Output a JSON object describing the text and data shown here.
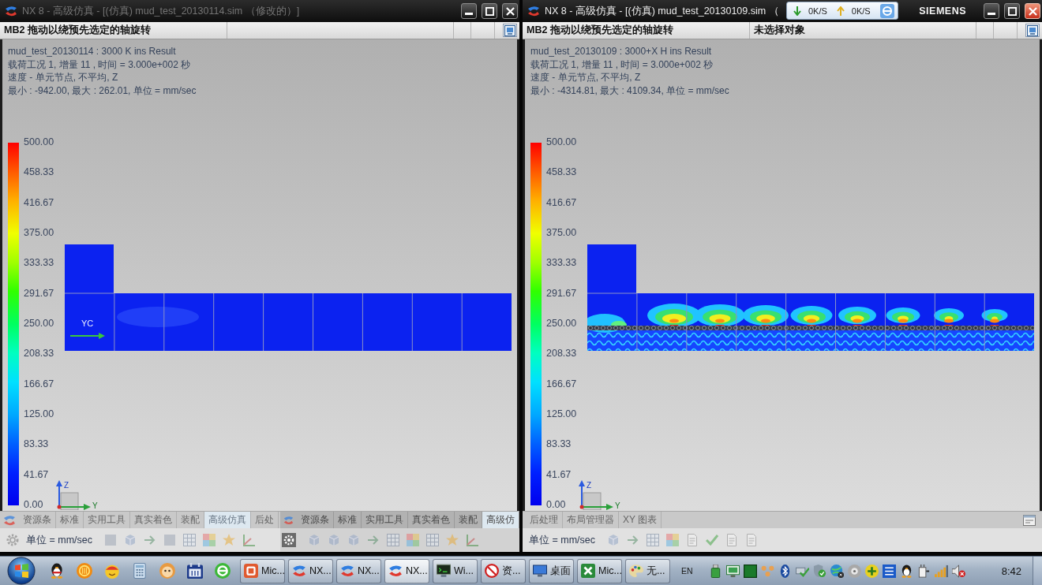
{
  "windows": [
    {
      "title": "NX 8 - 高级仿真 - [(仿真) mud_test_20130114.sim （修改的）]",
      "active": false,
      "cue": "MB2 拖动以绕预先选定的轴旋转",
      "info_lines": [
        "mud_test_20130114 : 3000 K ins Result",
        "载荷工况 1, 增量 11 , 时间 =  3.000e+002 秒",
        "速度 - 单元节点, 不平均, Z",
        "最小 : -942.00, 最大 : 262.01, 单位 = mm/sec"
      ],
      "legend_labels": [
        "500.00",
        "458.33",
        "416.67",
        "375.00",
        "333.33",
        "291.67",
        "250.00",
        "208.33",
        "166.67",
        "125.00",
        "83.33",
        "41.67",
        "0.00"
      ],
      "plot": {
        "kind": "uniform",
        "wcs_label": "YC"
      },
      "triad_labels": [
        "Z",
        "Y"
      ],
      "ribbon_tabs": [
        {
          "label": "资源条",
          "selected": false
        },
        {
          "label": "标准",
          "selected": false
        },
        {
          "label": "实用工具",
          "selected": false
        },
        {
          "label": "真实着色",
          "selected": false
        },
        {
          "label": "装配",
          "selected": false
        },
        {
          "label": "高级仿真",
          "selected": true
        },
        {
          "label": "后处",
          "selected": false
        }
      ],
      "overlay_tabs": [
        {
          "label": "资源条",
          "selected": false
        },
        {
          "label": "标准",
          "selected": false
        },
        {
          "label": "实用工具",
          "selected": false
        },
        {
          "label": "真实着色",
          "selected": false
        },
        {
          "label": "装配",
          "selected": false
        },
        {
          "label": "高级仿",
          "selected": true
        }
      ],
      "unit_label": "单位 = mm/sec"
    },
    {
      "title": "NX 8 - 高级仿真 - [(仿真) mud_test_20130109.sim （",
      "active": true,
      "net_monitor": {
        "download": "0K/S",
        "upload": "0K/S"
      },
      "brand": "SIEMENS",
      "cue": "MB2 拖动以绕预先选定的轴旋转",
      "status": "未选择对象",
      "info_lines": [
        "mud_test_20130109 : 3000+X H ins Result",
        "载荷工况 1, 增量 11 , 时间 =  3.000e+002 秒",
        "速度 - 单元节点, 不平均, Z",
        "最小 : -4314.81, 最大 : 4109.34, 单位 = mm/sec"
      ],
      "legend_labels": [
        "500.00",
        "458.33",
        "416.67",
        "375.00",
        "333.33",
        "291.67",
        "250.00",
        "208.33",
        "166.67",
        "125.00",
        "83.33",
        "41.67",
        "0.00"
      ],
      "plot": {
        "kind": "contours"
      },
      "triad_labels": [
        "Z",
        "Y"
      ],
      "ribbon_tabs": [
        {
          "label": "后处理",
          "selected": false
        },
        {
          "label": "布局管理器",
          "selected": false
        },
        {
          "label": "XY 图表",
          "selected": false
        }
      ],
      "unit_label": "单位 = mm/sec"
    }
  ],
  "taskbar": {
    "tasks": [
      {
        "kind": "office",
        "label": "Mic...",
        "selected": false
      },
      {
        "kind": "nx",
        "label": "NX...",
        "selected": false
      },
      {
        "kind": "nx",
        "label": "NX...",
        "selected": false
      },
      {
        "kind": "nx",
        "label": "NX...",
        "selected": true
      },
      {
        "kind": "terminal",
        "label": "Wi...",
        "selected": false
      },
      {
        "kind": "blocked",
        "label": "资...",
        "selected": false
      },
      {
        "kind": "desktop",
        "label": "桌面",
        "selected": false
      },
      {
        "kind": "excel",
        "label": "Mic...",
        "selected": false
      },
      {
        "kind": "paint",
        "label": "无...",
        "selected": false
      }
    ],
    "language": "EN",
    "clock": "8:42"
  }
}
